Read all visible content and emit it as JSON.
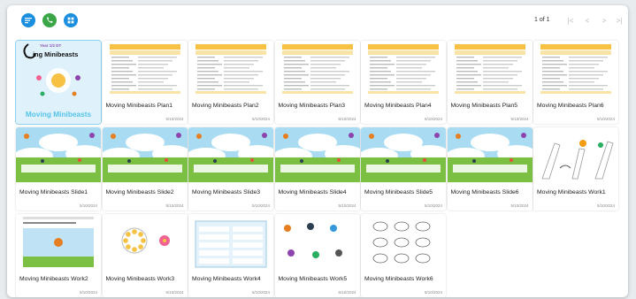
{
  "toolbar": {
    "buttons": [
      {
        "name": "sort-icon",
        "color": "#1a8fe0"
      },
      {
        "name": "phone-icon",
        "color": "#3aa647"
      },
      {
        "name": "grid-view-icon",
        "color": "#1a8fe0"
      }
    ],
    "pagination": {
      "page_text": "1 of 1",
      "first": "|<",
      "prev": "<",
      "next": ">",
      "last": ">|"
    }
  },
  "files": [
    {
      "title": "",
      "date": "",
      "type": "cover",
      "cover_text": "Moving Minibeasts",
      "cover_label": "Year 1/2 DT",
      "cover_heading": "ing Minibeasts",
      "selected": true
    },
    {
      "title": "Moving Minibeasts Plan1",
      "date": "5/10/2024",
      "type": "plan"
    },
    {
      "title": "Moving Minibeasts Plan2",
      "date": "5/10/2024",
      "type": "plan"
    },
    {
      "title": "Moving Minibeasts Plan3",
      "date": "5/10/2024",
      "type": "plan"
    },
    {
      "title": "Moving Minibeasts Plan4",
      "date": "5/10/2024",
      "type": "plan"
    },
    {
      "title": "Moving Minibeasts Plan5",
      "date": "5/10/2024",
      "type": "plan"
    },
    {
      "title": "Moving Minibeasts Plan6",
      "date": "5/10/2024",
      "type": "plan"
    },
    {
      "title": "Moving Minibeasts Slide1",
      "date": "5/10/2024",
      "type": "slide"
    },
    {
      "title": "Moving Minibeasts Slide2",
      "date": "5/10/2024",
      "type": "slide"
    },
    {
      "title": "Moving Minibeasts Slide3",
      "date": "5/10/2024",
      "type": "slide"
    },
    {
      "title": "Moving Minibeasts Slide4",
      "date": "5/10/2024",
      "type": "slide"
    },
    {
      "title": "Moving Minibeasts Slide5",
      "date": "5/10/2024",
      "type": "slide"
    },
    {
      "title": "Moving Minibeasts Slide6",
      "date": "5/10/2024",
      "type": "slide"
    },
    {
      "title": "Moving Minibeasts Work1",
      "date": "5/10/2024",
      "type": "work1"
    },
    {
      "title": "Moving Minibeasts Work2",
      "date": "5/10/2024",
      "type": "work2"
    },
    {
      "title": "Moving Minibeasts Work3",
      "date": "5/10/2024",
      "type": "work3"
    },
    {
      "title": "Moving Minibeasts Work4",
      "date": "5/10/2024",
      "type": "work4"
    },
    {
      "title": "Moving Minibeasts Work5",
      "date": "5/10/2024",
      "type": "work5"
    },
    {
      "title": "Moving Minibeasts Work6",
      "date": "5/10/2024",
      "type": "work6"
    }
  ]
}
